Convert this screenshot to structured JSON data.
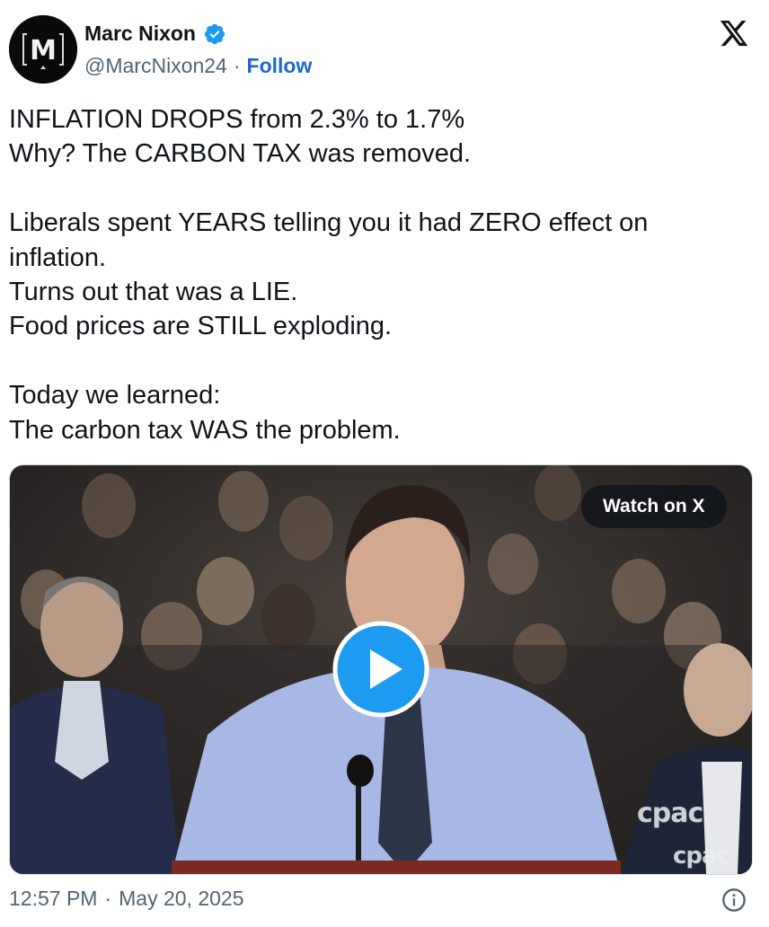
{
  "author": {
    "name": "Marc Nixon",
    "handle": "@MarcNixon24",
    "separator": "·",
    "follow_label": "Follow",
    "avatar_letter": "M",
    "verified": true,
    "verified_color": "#1d9bf0"
  },
  "brand": {
    "logo_icon": "x-logo-icon"
  },
  "tweet": {
    "paragraphs": [
      [
        "INFLATION DROPS from 2.3% to 1.7%",
        "Why? The CARBON TAX was removed."
      ],
      [
        "Liberals spent YEARS telling you it had ZERO effect on",
        "inflation.",
        "Turns out that was a LIE.",
        "Food prices are STILL exploding."
      ],
      [
        "Today we learned:",
        "The carbon tax WAS the problem."
      ]
    ]
  },
  "media": {
    "watch_label": "Watch on X",
    "play_icon": "play-icon",
    "watermark_1": "cpac",
    "watermark_2": "cpac"
  },
  "footer": {
    "time": "12:57 PM",
    "separator": "·",
    "date": "May 20, 2025",
    "info_icon": "info-icon"
  },
  "colors": {
    "text": "#0f1419",
    "secondary": "#536471",
    "link": "#1d67d1",
    "play_button": "#1d9bf0"
  }
}
